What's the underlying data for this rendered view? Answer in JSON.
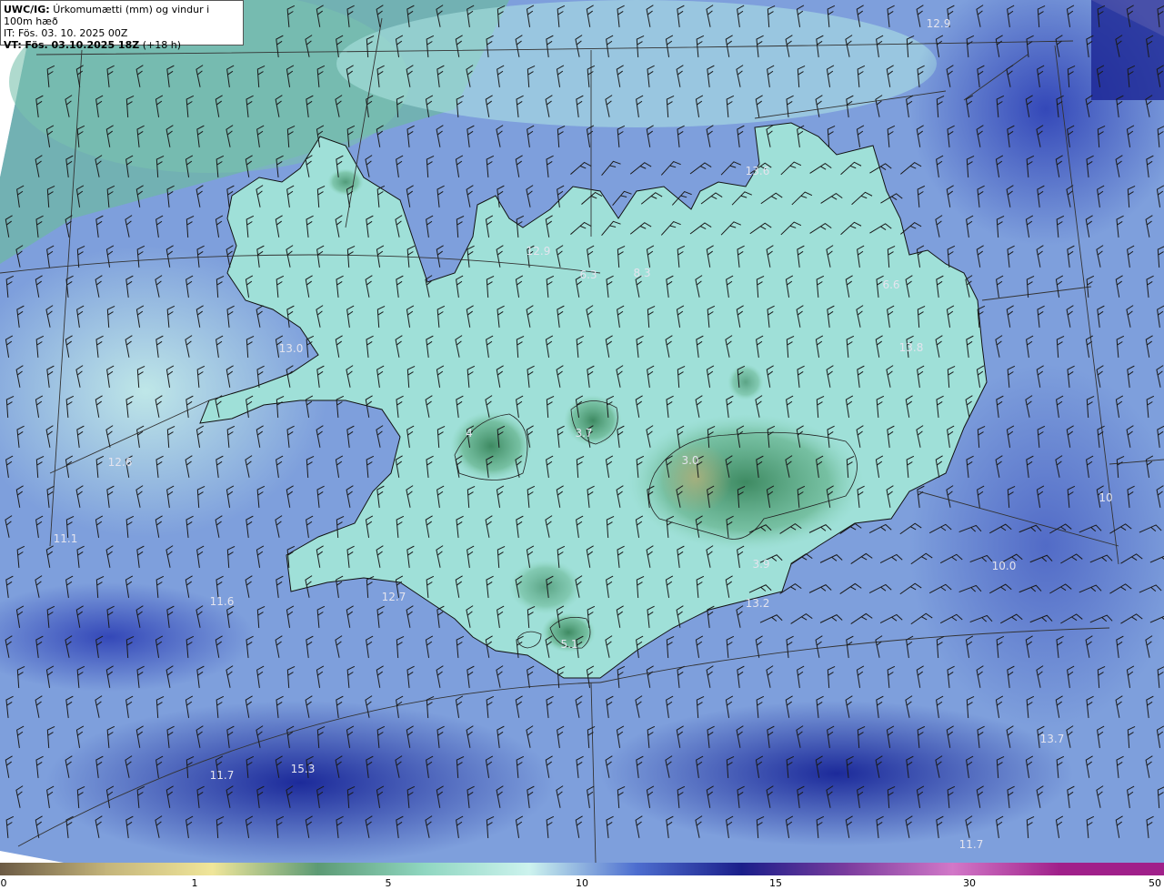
{
  "header": {
    "product_code": "UWC/IG:",
    "product_title": "Úrkomumætti (mm) og vindur i 100m hæð",
    "init_time": "IT: Fös. 03. 10. 2025 00Z",
    "valid_label": "VT:",
    "valid_time": "Fös. 03.10.2025 18Z",
    "lead_time": "(+18 h)"
  },
  "map_labels": [
    {
      "text": "13.6"
    },
    {
      "text": "12.9"
    },
    {
      "text": "6.3"
    },
    {
      "text": "8.3"
    },
    {
      "text": "6.6"
    },
    {
      "text": "13.0"
    },
    {
      "text": "13.8"
    },
    {
      "text": "3.7"
    },
    {
      "text": "3.0"
    },
    {
      "text": "12.6"
    },
    {
      "text": "11.1"
    },
    {
      "text": "11.6"
    },
    {
      "text": "12.7"
    },
    {
      "text": "3.9"
    },
    {
      "text": "10.0"
    },
    {
      "text": "10"
    },
    {
      "text": "5.1"
    },
    {
      "text": "13.2"
    },
    {
      "text": "11.7"
    },
    {
      "text": "15.3"
    },
    {
      "text": "13.7"
    },
    {
      "text": "11.7"
    },
    {
      "text": "4"
    },
    {
      "text": "12.9"
    }
  ],
  "colorbar": {
    "ticks": [
      "0",
      "1",
      "5",
      "10",
      "15",
      "30",
      "50"
    ],
    "colors": [
      "#6b5a44",
      "#c4b47a",
      "#f0e69a",
      "#5c9a74",
      "#8fd6c0",
      "#cdf3ee",
      "#4e6fd0",
      "#1a1e8a",
      "#7b3c9e",
      "#d278c8",
      "#a0208a"
    ]
  }
}
